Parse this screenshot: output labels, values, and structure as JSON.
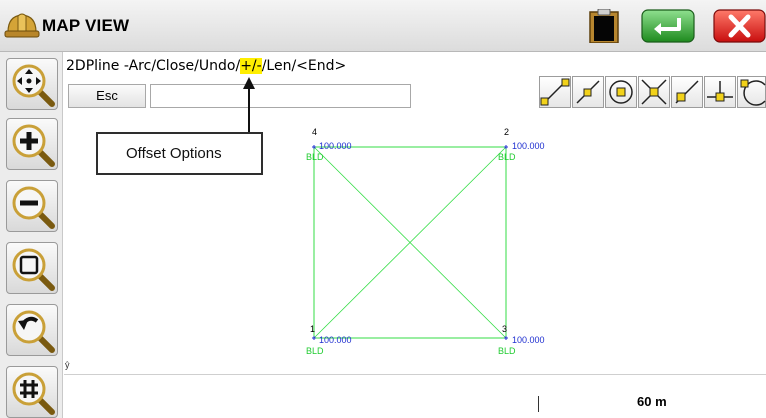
{
  "app": {
    "title": "MAP VIEW"
  },
  "command": {
    "prefix": "2DPline -Arc/Close/Undo/",
    "highlight": "+/-",
    "suffix": "/Len/<End>",
    "esc_label": "Esc",
    "input_value": ""
  },
  "callout": {
    "text": "Offset Options"
  },
  "points": [
    {
      "id": "4",
      "elevation": "100.000",
      "description": "BLD"
    },
    {
      "id": "2",
      "elevation": "100.000",
      "description": "BLD"
    },
    {
      "id": "1",
      "elevation": "100.000",
      "description": "BLD"
    },
    {
      "id": "3",
      "elevation": "100.000",
      "description": "BLD"
    }
  ],
  "scale": {
    "label": "60 m"
  },
  "axis": {
    "label": "ŷ"
  },
  "colors": {
    "line_green": "#33dd44",
    "elevation_blue": "#1f2fd0",
    "highlight_yellow": "#ffee00",
    "close_red": "#e02020",
    "enter_green": "#2aa02a"
  },
  "icons": {
    "left_toolbar": [
      "pan-icon",
      "zoom-in-icon",
      "zoom-out-icon",
      "zoom-extents-icon",
      "zoom-previous-icon",
      "grid-icon"
    ],
    "snap_toolbar": [
      "snap-endpoint-icon",
      "snap-midpoint-icon",
      "snap-center-icon",
      "snap-intersection-icon",
      "snap-nearest-icon",
      "snap-perpendicular-icon",
      "snap-tangent-icon"
    ],
    "title_bar": [
      "hard-hat-icon",
      "clipboard-icon",
      "enter-icon",
      "close-icon"
    ]
  }
}
